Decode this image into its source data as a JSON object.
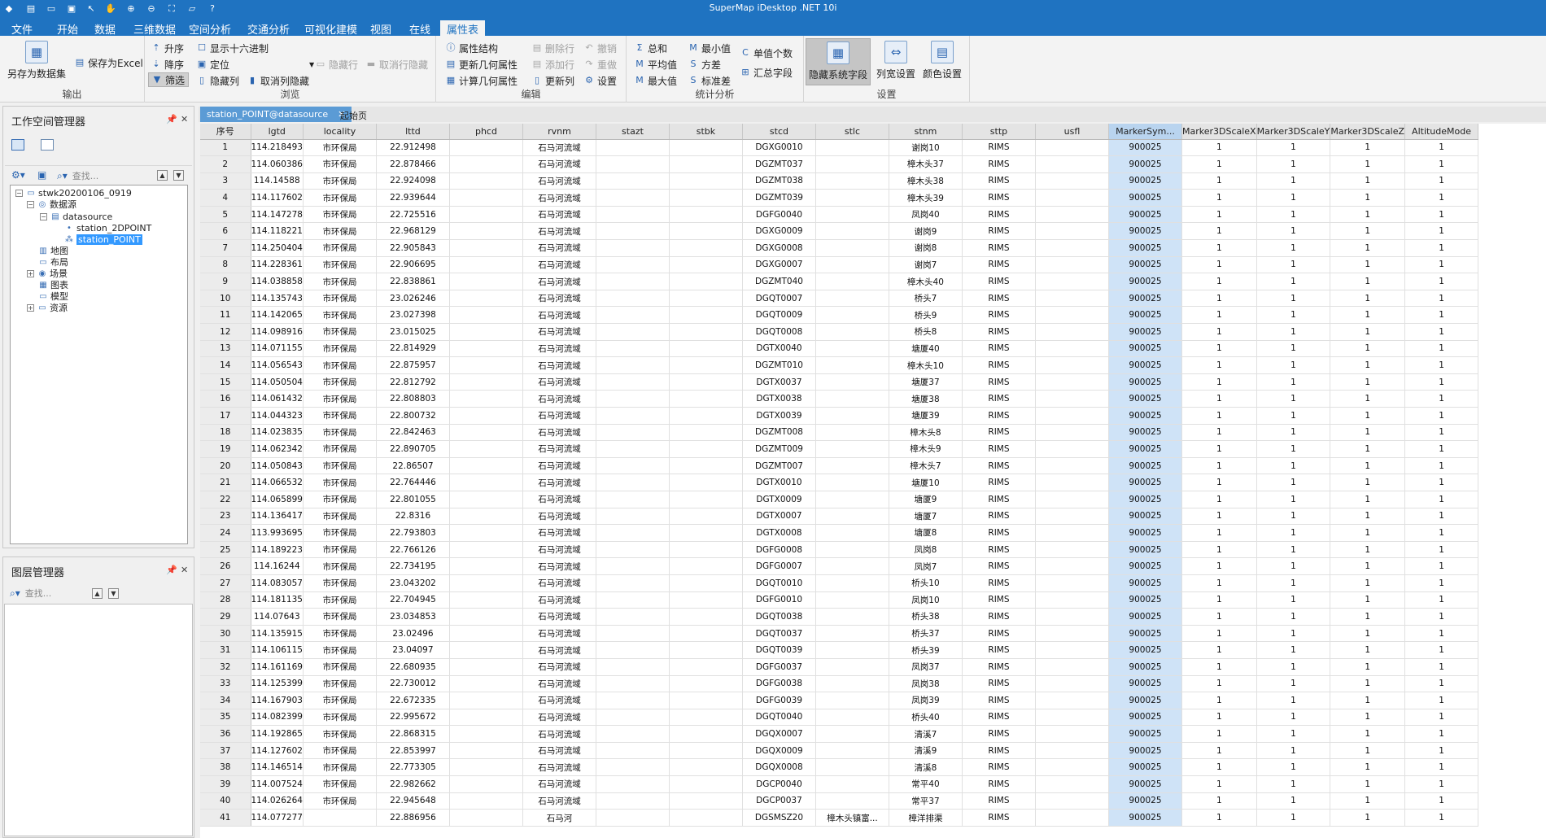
{
  "app": {
    "title": "SuperMap iDesktop .NET 10i",
    "quick_access_icons": [
      "app-logo-icon",
      "save-icon",
      "new-icon",
      "open-icon",
      "pointer-icon",
      "pan-icon",
      "zoom-in-icon",
      "zoom-out-icon",
      "full-extent-icon",
      "folder-icon",
      "help-icon"
    ],
    "quick_access_glyphs": [
      "◆",
      "▤",
      "▭",
      "▣",
      "↖",
      "✋",
      "⊕",
      "⊖",
      "⛶",
      "▱",
      "?"
    ]
  },
  "menu": [
    "文件",
    "开始",
    "数据",
    "三维数据",
    "空间分析",
    "交通分析",
    "可视化建模",
    "视图",
    "在线",
    "属性表"
  ],
  "ribbon": {
    "output": {
      "label": "输出",
      "save_dataset": "另存为数据集",
      "save_excel": "保存为Excel"
    },
    "browse": {
      "label": "浏览",
      "asc": "升序",
      "desc": "降序",
      "filter": "筛选",
      "show_hex": "显示十六进制",
      "locate": "定位",
      "hide_col": "隐藏列",
      "hide_row": "隐藏行",
      "unhide_col": "取消列隐藏",
      "unhide_row": "取消行隐藏"
    },
    "edit": {
      "label": "编辑",
      "attr_struct": "属性结构",
      "update_geo": "更新几何属性",
      "calc_geo": "计算几何属性",
      "delete_row": "删除行",
      "add_row": "添加行",
      "update_col": "更新列",
      "undo": "撤销",
      "redo": "重做",
      "settings": "设置"
    },
    "stats": {
      "label": "统计分析",
      "sum": "总和",
      "avg": "平均值",
      "max": "最大值",
      "min": "最小值",
      "var": "方差",
      "std": "标准差",
      "unique": "单值个数",
      "summary": "汇总字段"
    },
    "settings": {
      "label": "设置",
      "hide_sys": "隐藏系统字段",
      "col_width": "列宽设置",
      "color": "颜色设置"
    }
  },
  "workspace_panel": {
    "title": "工作空间管理器",
    "search_placeholder": "查找...",
    "tree": {
      "root": "stwk20200106_0919",
      "datasources": "数据源",
      "datasource": "datasource",
      "ds1": "station_2DPOINT",
      "ds2": "station_POINT",
      "maps": "地图",
      "layouts": "布局",
      "scenes": "场景",
      "charts": "图表",
      "models": "模型",
      "resources": "资源"
    }
  },
  "layer_panel": {
    "title": "图层管理器",
    "search_placeholder": "查找..."
  },
  "doc_tabs": [
    {
      "label": "station_POINT@datasource",
      "active": true
    },
    {
      "label": "起始页",
      "active": false
    }
  ],
  "table": {
    "columns": [
      "序号",
      "lgtd",
      "locality",
      "lttd",
      "phcd",
      "rvnm",
      "stazt",
      "stbk",
      "stcd",
      "stlc",
      "stnm",
      "sttp",
      "usfl",
      "MarkerSym...",
      "Marker3DScaleX",
      "Marker3DScaleY",
      "Marker3DScaleZ",
      "AltitudeMode"
    ],
    "rows": [
      [
        "1",
        "114.218493",
        "市环保局",
        "22.912498",
        "",
        "石马河流域",
        "",
        "",
        "DGXG0010",
        "",
        "谢岗10",
        "RIMS",
        "",
        "900025",
        "1",
        "1",
        "1",
        "1"
      ],
      [
        "2",
        "114.060386",
        "市环保局",
        "22.878466",
        "",
        "石马河流域",
        "",
        "",
        "DGZMT037",
        "",
        "樟木头37",
        "RIMS",
        "",
        "900025",
        "1",
        "1",
        "1",
        "1"
      ],
      [
        "3",
        "114.14588",
        "市环保局",
        "22.924098",
        "",
        "石马河流域",
        "",
        "",
        "DGZMT038",
        "",
        "樟木头38",
        "RIMS",
        "",
        "900025",
        "1",
        "1",
        "1",
        "1"
      ],
      [
        "4",
        "114.117602",
        "市环保局",
        "22.939644",
        "",
        "石马河流域",
        "",
        "",
        "DGZMT039",
        "",
        "樟木头39",
        "RIMS",
        "",
        "900025",
        "1",
        "1",
        "1",
        "1"
      ],
      [
        "5",
        "114.147278",
        "市环保局",
        "22.725516",
        "",
        "石马河流域",
        "",
        "",
        "DGFG0040",
        "",
        "凤岗40",
        "RIMS",
        "",
        "900025",
        "1",
        "1",
        "1",
        "1"
      ],
      [
        "6",
        "114.118221",
        "市环保局",
        "22.968129",
        "",
        "石马河流域",
        "",
        "",
        "DGXG0009",
        "",
        "谢岗9",
        "RIMS",
        "",
        "900025",
        "1",
        "1",
        "1",
        "1"
      ],
      [
        "7",
        "114.250404",
        "市环保局",
        "22.905843",
        "",
        "石马河流域",
        "",
        "",
        "DGXG0008",
        "",
        "谢岗8",
        "RIMS",
        "",
        "900025",
        "1",
        "1",
        "1",
        "1"
      ],
      [
        "8",
        "114.228361",
        "市环保局",
        "22.906695",
        "",
        "石马河流域",
        "",
        "",
        "DGXG0007",
        "",
        "谢岗7",
        "RIMS",
        "",
        "900025",
        "1",
        "1",
        "1",
        "1"
      ],
      [
        "9",
        "114.038858",
        "市环保局",
        "22.838861",
        "",
        "石马河流域",
        "",
        "",
        "DGZMT040",
        "",
        "樟木头40",
        "RIMS",
        "",
        "900025",
        "1",
        "1",
        "1",
        "1"
      ],
      [
        "10",
        "114.135743",
        "市环保局",
        "23.026246",
        "",
        "石马河流域",
        "",
        "",
        "DGQT0007",
        "",
        "桥头7",
        "RIMS",
        "",
        "900025",
        "1",
        "1",
        "1",
        "1"
      ],
      [
        "11",
        "114.142065",
        "市环保局",
        "23.027398",
        "",
        "石马河流域",
        "",
        "",
        "DGQT0009",
        "",
        "桥头9",
        "RIMS",
        "",
        "900025",
        "1",
        "1",
        "1",
        "1"
      ],
      [
        "12",
        "114.098916",
        "市环保局",
        "23.015025",
        "",
        "石马河流域",
        "",
        "",
        "DGQT0008",
        "",
        "桥头8",
        "RIMS",
        "",
        "900025",
        "1",
        "1",
        "1",
        "1"
      ],
      [
        "13",
        "114.071155",
        "市环保局",
        "22.814929",
        "",
        "石马河流域",
        "",
        "",
        "DGTX0040",
        "",
        "塘厦40",
        "RIMS",
        "",
        "900025",
        "1",
        "1",
        "1",
        "1"
      ],
      [
        "14",
        "114.056543",
        "市环保局",
        "22.875957",
        "",
        "石马河流域",
        "",
        "",
        "DGZMT010",
        "",
        "樟木头10",
        "RIMS",
        "",
        "900025",
        "1",
        "1",
        "1",
        "1"
      ],
      [
        "15",
        "114.050504",
        "市环保局",
        "22.812792",
        "",
        "石马河流域",
        "",
        "",
        "DGTX0037",
        "",
        "塘厦37",
        "RIMS",
        "",
        "900025",
        "1",
        "1",
        "1",
        "1"
      ],
      [
        "16",
        "114.061432",
        "市环保局",
        "22.808803",
        "",
        "石马河流域",
        "",
        "",
        "DGTX0038",
        "",
        "塘厦38",
        "RIMS",
        "",
        "900025",
        "1",
        "1",
        "1",
        "1"
      ],
      [
        "17",
        "114.044323",
        "市环保局",
        "22.800732",
        "",
        "石马河流域",
        "",
        "",
        "DGTX0039",
        "",
        "塘厦39",
        "RIMS",
        "",
        "900025",
        "1",
        "1",
        "1",
        "1"
      ],
      [
        "18",
        "114.023835",
        "市环保局",
        "22.842463",
        "",
        "石马河流域",
        "",
        "",
        "DGZMT008",
        "",
        "樟木头8",
        "RIMS",
        "",
        "900025",
        "1",
        "1",
        "1",
        "1"
      ],
      [
        "19",
        "114.062342",
        "市环保局",
        "22.890705",
        "",
        "石马河流域",
        "",
        "",
        "DGZMT009",
        "",
        "樟木头9",
        "RIMS",
        "",
        "900025",
        "1",
        "1",
        "1",
        "1"
      ],
      [
        "20",
        "114.050843",
        "市环保局",
        "22.86507",
        "",
        "石马河流域",
        "",
        "",
        "DGZMT007",
        "",
        "樟木头7",
        "RIMS",
        "",
        "900025",
        "1",
        "1",
        "1",
        "1"
      ],
      [
        "21",
        "114.066532",
        "市环保局",
        "22.764446",
        "",
        "石马河流域",
        "",
        "",
        "DGTX0010",
        "",
        "塘厦10",
        "RIMS",
        "",
        "900025",
        "1",
        "1",
        "1",
        "1"
      ],
      [
        "22",
        "114.065899",
        "市环保局",
        "22.801055",
        "",
        "石马河流域",
        "",
        "",
        "DGTX0009",
        "",
        "塘厦9",
        "RIMS",
        "",
        "900025",
        "1",
        "1",
        "1",
        "1"
      ],
      [
        "23",
        "114.136417",
        "市环保局",
        "22.8316",
        "",
        "石马河流域",
        "",
        "",
        "DGTX0007",
        "",
        "塘厦7",
        "RIMS",
        "",
        "900025",
        "1",
        "1",
        "1",
        "1"
      ],
      [
        "24",
        "113.993695",
        "市环保局",
        "22.793803",
        "",
        "石马河流域",
        "",
        "",
        "DGTX0008",
        "",
        "塘厦8",
        "RIMS",
        "",
        "900025",
        "1",
        "1",
        "1",
        "1"
      ],
      [
        "25",
        "114.189223",
        "市环保局",
        "22.766126",
        "",
        "石马河流域",
        "",
        "",
        "DGFG0008",
        "",
        "凤岗8",
        "RIMS",
        "",
        "900025",
        "1",
        "1",
        "1",
        "1"
      ],
      [
        "26",
        "114.16244",
        "市环保局",
        "22.734195",
        "",
        "石马河流域",
        "",
        "",
        "DGFG0007",
        "",
        "凤岗7",
        "RIMS",
        "",
        "900025",
        "1",
        "1",
        "1",
        "1"
      ],
      [
        "27",
        "114.083057",
        "市环保局",
        "23.043202",
        "",
        "石马河流域",
        "",
        "",
        "DGQT0010",
        "",
        "桥头10",
        "RIMS",
        "",
        "900025",
        "1",
        "1",
        "1",
        "1"
      ],
      [
        "28",
        "114.181135",
        "市环保局",
        "22.704945",
        "",
        "石马河流域",
        "",
        "",
        "DGFG0010",
        "",
        "凤岗10",
        "RIMS",
        "",
        "900025",
        "1",
        "1",
        "1",
        "1"
      ],
      [
        "29",
        "114.07643",
        "市环保局",
        "23.034853",
        "",
        "石马河流域",
        "",
        "",
        "DGQT0038",
        "",
        "桥头38",
        "RIMS",
        "",
        "900025",
        "1",
        "1",
        "1",
        "1"
      ],
      [
        "30",
        "114.135915",
        "市环保局",
        "23.02496",
        "",
        "石马河流域",
        "",
        "",
        "DGQT0037",
        "",
        "桥头37",
        "RIMS",
        "",
        "900025",
        "1",
        "1",
        "1",
        "1"
      ],
      [
        "31",
        "114.106115",
        "市环保局",
        "23.04097",
        "",
        "石马河流域",
        "",
        "",
        "DGQT0039",
        "",
        "桥头39",
        "RIMS",
        "",
        "900025",
        "1",
        "1",
        "1",
        "1"
      ],
      [
        "32",
        "114.161169",
        "市环保局",
        "22.680935",
        "",
        "石马河流域",
        "",
        "",
        "DGFG0037",
        "",
        "凤岗37",
        "RIMS",
        "",
        "900025",
        "1",
        "1",
        "1",
        "1"
      ],
      [
        "33",
        "114.125399",
        "市环保局",
        "22.730012",
        "",
        "石马河流域",
        "",
        "",
        "DGFG0038",
        "",
        "凤岗38",
        "RIMS",
        "",
        "900025",
        "1",
        "1",
        "1",
        "1"
      ],
      [
        "34",
        "114.167903",
        "市环保局",
        "22.672335",
        "",
        "石马河流域",
        "",
        "",
        "DGFG0039",
        "",
        "凤岗39",
        "RIMS",
        "",
        "900025",
        "1",
        "1",
        "1",
        "1"
      ],
      [
        "35",
        "114.082399",
        "市环保局",
        "22.995672",
        "",
        "石马河流域",
        "",
        "",
        "DGQT0040",
        "",
        "桥头40",
        "RIMS",
        "",
        "900025",
        "1",
        "1",
        "1",
        "1"
      ],
      [
        "36",
        "114.192865",
        "市环保局",
        "22.868315",
        "",
        "石马河流域",
        "",
        "",
        "DGQX0007",
        "",
        "清溪7",
        "RIMS",
        "",
        "900025",
        "1",
        "1",
        "1",
        "1"
      ],
      [
        "37",
        "114.127602",
        "市环保局",
        "22.853997",
        "",
        "石马河流域",
        "",
        "",
        "DGQX0009",
        "",
        "清溪9",
        "RIMS",
        "",
        "900025",
        "1",
        "1",
        "1",
        "1"
      ],
      [
        "38",
        "114.146514",
        "市环保局",
        "22.773305",
        "",
        "石马河流域",
        "",
        "",
        "DGQX0008",
        "",
        "清溪8",
        "RIMS",
        "",
        "900025",
        "1",
        "1",
        "1",
        "1"
      ],
      [
        "39",
        "114.007524",
        "市环保局",
        "22.982662",
        "",
        "石马河流域",
        "",
        "",
        "DGCP0040",
        "",
        "常平40",
        "RIMS",
        "",
        "900025",
        "1",
        "1",
        "1",
        "1"
      ],
      [
        "40",
        "114.026264",
        "市环保局",
        "22.945648",
        "",
        "石马河流域",
        "",
        "",
        "DGCP0037",
        "",
        "常平37",
        "RIMS",
        "",
        "900025",
        "1",
        "1",
        "1",
        "1"
      ],
      [
        "41",
        "114.077277",
        "",
        "22.886956",
        "",
        "石马河",
        "",
        "",
        "DGSMSZ20",
        "樟木头镇富...",
        "樟洋排渠",
        "RIMS",
        "",
        "900025",
        "1",
        "1",
        "1",
        "1"
      ]
    ]
  },
  "colors": {
    "titlebar": "#1f73c1",
    "ribbon_bg": "#f3f3f3",
    "highlight_col": "#cfe3f7",
    "selected": "#3399ff"
  }
}
